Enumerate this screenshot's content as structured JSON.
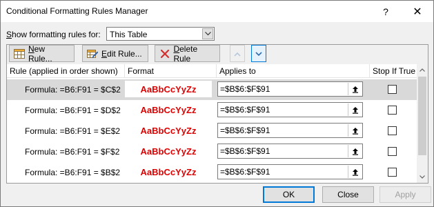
{
  "window": {
    "title": "Conditional Formatting Rules Manager",
    "help_glyph": "?",
    "close_glyph": "✕"
  },
  "show_rules": {
    "label_accel": "S",
    "label_rest": "how formatting rules for:",
    "selected": "This Table"
  },
  "toolbar": {
    "new_accel": "N",
    "new_rest": "ew Rule...",
    "edit_accel": "E",
    "edit_rest": "dit Rule...",
    "delete_accel": "D",
    "delete_rest": "elete Rule",
    "up_icon": "chevron-up-icon",
    "down_icon": "chevron-down-icon"
  },
  "columns": {
    "rule": "Rule (applied in order shown)",
    "format": "Format",
    "applies": "Applies to",
    "stop": "Stop If True"
  },
  "rules": [
    {
      "rule": "Formula: =B6:F91 = $C$2",
      "format": "AaBbCcYyZz",
      "applies": "=$B$6:$F$91",
      "stop": false,
      "selected": true
    },
    {
      "rule": "Formula: =B6:F91 = $D$2",
      "format": "AaBbCcYyZz",
      "applies": "=$B$6:$F$91",
      "stop": false,
      "selected": false
    },
    {
      "rule": "Formula: =B6:F91 = $E$2",
      "format": "AaBbCcYyZz",
      "applies": "=$B$6:$F$91",
      "stop": false,
      "selected": false
    },
    {
      "rule": "Formula: =B6:F91 = $F$2",
      "format": "AaBbCcYyZz",
      "applies": "=$B$6:$F$91",
      "stop": false,
      "selected": false
    },
    {
      "rule": "Formula: =B6:F91 = $B$2",
      "format": "AaBbCcYyZz",
      "applies": "=$B$6:$F$91",
      "stop": false,
      "selected": false
    }
  ],
  "footer": {
    "ok": "OK",
    "close": "Close",
    "apply": "Apply"
  },
  "colors": {
    "format_preview": "#e00000",
    "accent": "#0078d7"
  }
}
